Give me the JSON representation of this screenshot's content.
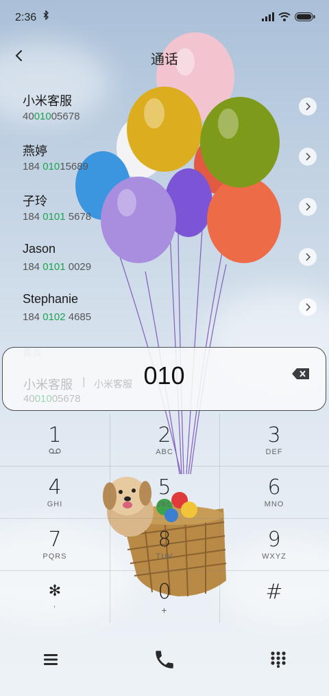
{
  "status": {
    "time": "2:36"
  },
  "header": {
    "title": "通话"
  },
  "contacts": [
    {
      "name": "小米客服",
      "num_pre": "40",
      "num_hl": "010",
      "num_post": "05678"
    },
    {
      "name": "燕婷",
      "num_pre": "184 ",
      "num_hl": "010",
      "num_post": "15689"
    },
    {
      "name": "子玲",
      "num_pre": "184 ",
      "num_hl": "0101",
      "num_post": " 5678"
    },
    {
      "name": "Jason",
      "num_pre": "184 ",
      "num_hl": "0101",
      "num_post": " 0029"
    },
    {
      "name": "Stephanie",
      "num_pre": "184 ",
      "num_hl": "0102",
      "num_post": " 4685"
    }
  ],
  "yellow_pages": {
    "label": "黄页",
    "name": "小米客服",
    "sub": "小米客服",
    "num_pre": "40",
    "num_hl": "010",
    "num_post": "05678"
  },
  "dial": {
    "digits": "010"
  },
  "keypad": [
    {
      "digit": "1",
      "letters": ""
    },
    {
      "digit": "2",
      "letters": "ABC"
    },
    {
      "digit": "3",
      "letters": "DEF"
    },
    {
      "digit": "4",
      "letters": "GHI"
    },
    {
      "digit": "5",
      "letters": "JKL"
    },
    {
      "digit": "6",
      "letters": "MNO"
    },
    {
      "digit": "7",
      "letters": "PQRS"
    },
    {
      "digit": "8",
      "letters": "TUV"
    },
    {
      "digit": "9",
      "letters": "WXYZ"
    },
    {
      "digit": "✻",
      "letters": ","
    },
    {
      "digit": "0",
      "letters": "+"
    },
    {
      "digit": "#",
      "letters": ""
    }
  ],
  "icons": {
    "bluetooth": "bluetooth-icon",
    "wifi": "wifi-icon",
    "battery": "battery-icon",
    "back": "back-arrow-icon",
    "chevron": "chevron-right-icon",
    "backspace": "backspace-icon",
    "voicemail": "voicemail-icon",
    "menu": "menu-icon",
    "call": "phone-icon",
    "dialpad": "dialpad-icon"
  },
  "colors": {
    "highlight": "#1ea34e",
    "text": "#222222"
  }
}
